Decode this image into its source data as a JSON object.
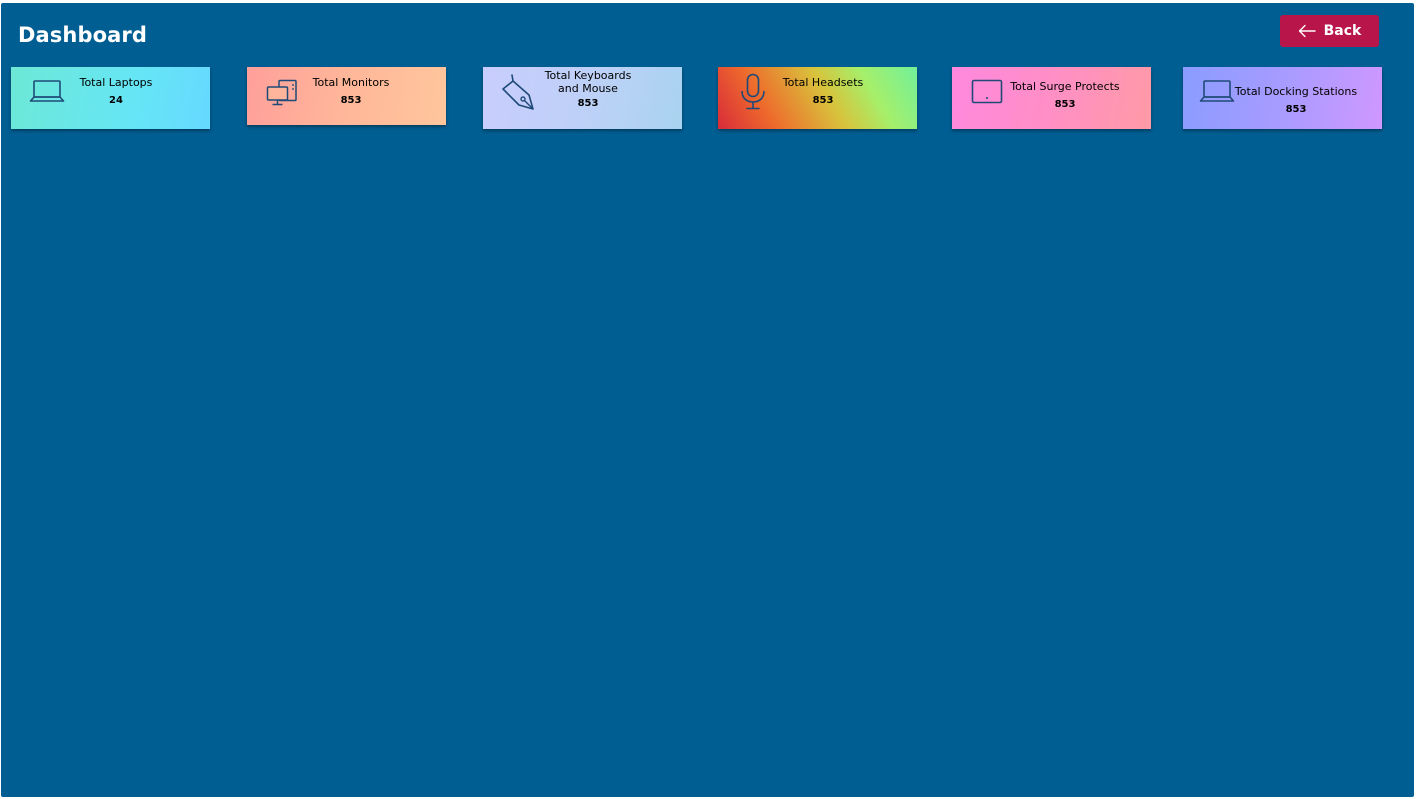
{
  "header": {
    "title": "Dashboard",
    "back_label": "Back"
  },
  "colors": {
    "background": "#005e92",
    "back_button": "#b8154b",
    "icon_stroke": "#1f4a78"
  },
  "cards": [
    {
      "label": "Total Laptops",
      "value": "24",
      "icon": "laptop-icon"
    },
    {
      "label": "Total Monitors",
      "value": "853",
      "icon": "monitors-icon"
    },
    {
      "label": "Total Keyboards and Mouse",
      "value": "853",
      "icon": "pen-icon"
    },
    {
      "label": "Total Headsets",
      "value": "853",
      "icon": "microphone-icon"
    },
    {
      "label": "Total Surge Protects",
      "value": "853",
      "icon": "tablet-icon"
    },
    {
      "label": "Total Docking Stations",
      "value": "853",
      "icon": "laptop-icon"
    }
  ]
}
